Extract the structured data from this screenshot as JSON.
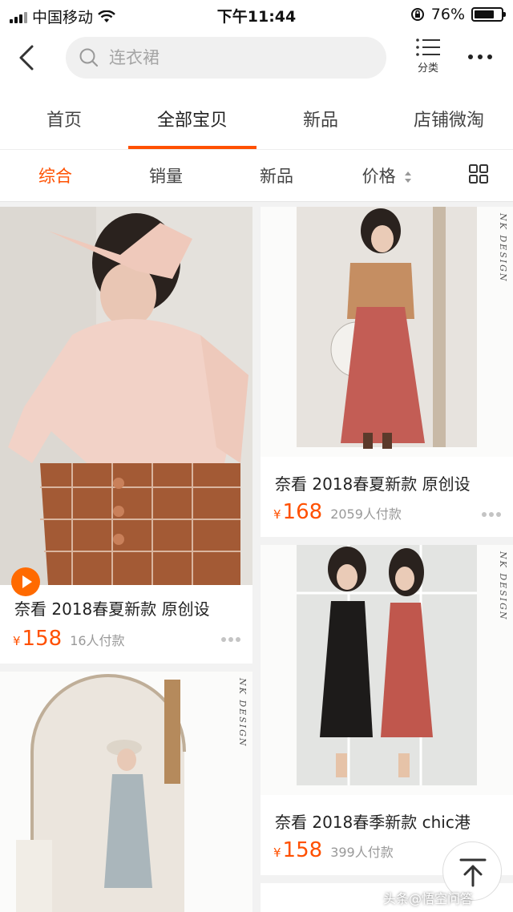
{
  "status_bar": {
    "carrier": "中国移动",
    "time": "下午11:44",
    "battery_percent": "76%",
    "battery_level": 0.76
  },
  "header": {
    "search_placeholder": "连衣裙",
    "category_label": "分类"
  },
  "tabs": [
    {
      "label": "首页",
      "active": false
    },
    {
      "label": "全部宝贝",
      "active": true
    },
    {
      "label": "新品",
      "active": false
    },
    {
      "label": "店铺微淘",
      "active": false
    }
  ],
  "sort": {
    "items": [
      {
        "label": "综合",
        "active": true
      },
      {
        "label": "销量",
        "active": false
      },
      {
        "label": "新品",
        "active": false
      },
      {
        "label": "价格",
        "active": false
      }
    ]
  },
  "products": [
    {
      "title": "奈看 2018春夏新款 原创设",
      "currency": "¥",
      "price": "158",
      "sold": "16人付款",
      "has_video": true
    },
    {
      "title": "奈看 2018春夏新款 原创设",
      "currency": "¥",
      "price": "168",
      "sold": "2059人付款",
      "brand": "NK DESIGN"
    },
    {
      "title": "奈看 2018春季新款 chic港",
      "currency": "¥",
      "price": "158",
      "sold": "399人付款",
      "brand": "NK DESIGN"
    },
    {
      "brand": "NK DESIGN"
    }
  ],
  "watermark": "头条@悟空问答",
  "colors": {
    "accent": "#ff5000",
    "background": "#f2f2f2"
  },
  "icons": [
    "back-icon",
    "search-icon",
    "list-icon",
    "more-icon",
    "sort-arrows-icon",
    "grid-icon",
    "play-icon",
    "back-to-top-icon"
  ]
}
